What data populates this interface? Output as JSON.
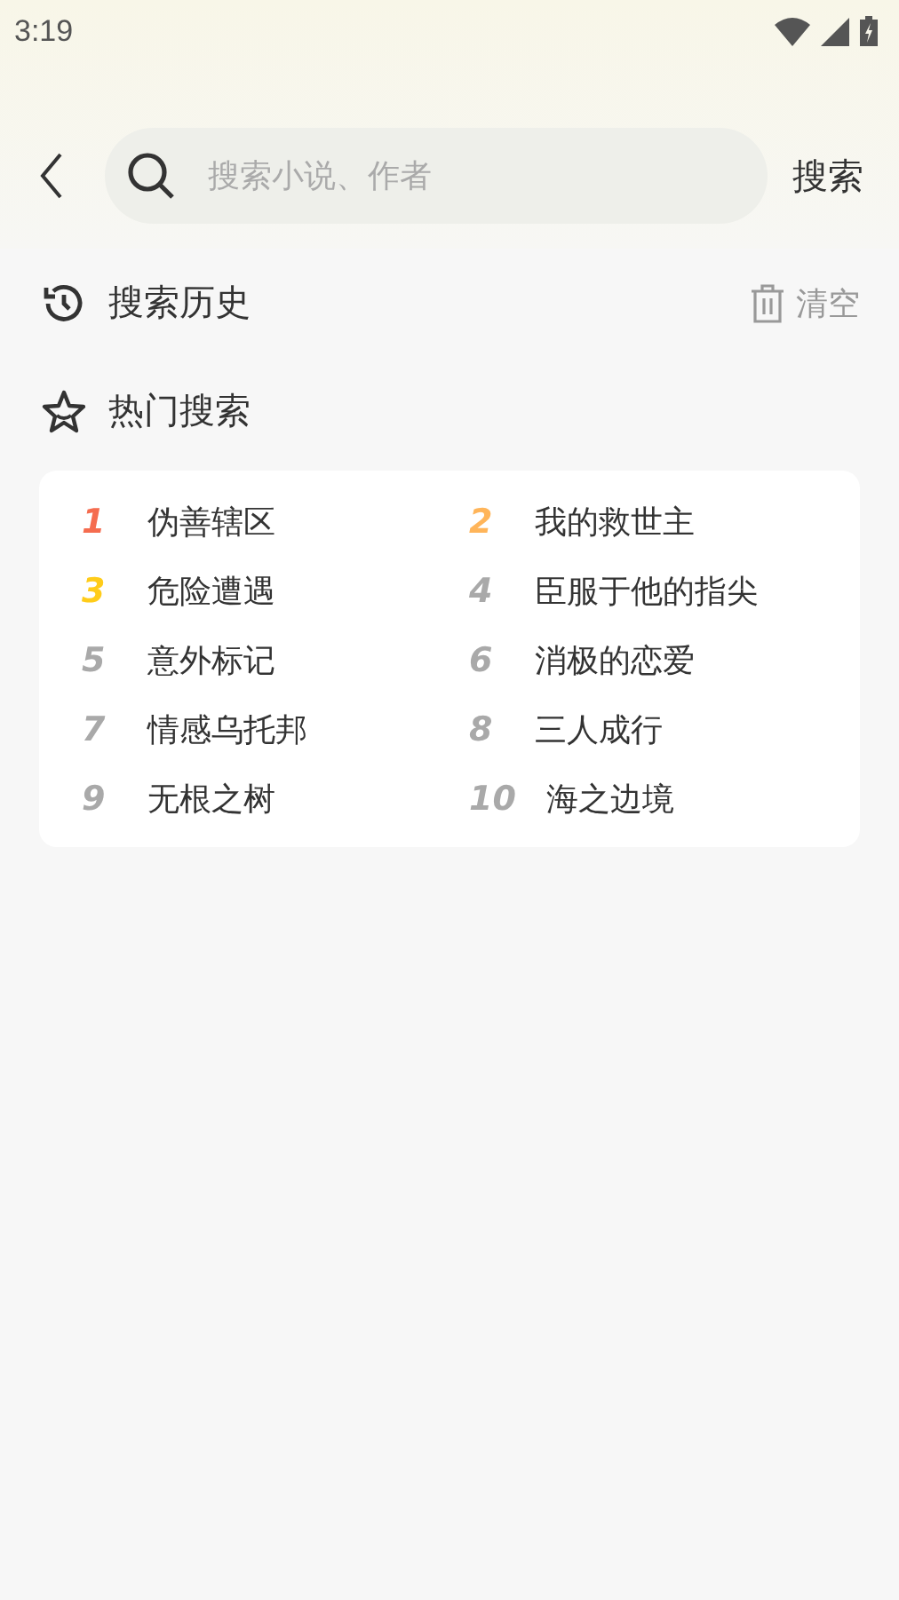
{
  "status_bar": {
    "time": "3:19"
  },
  "search": {
    "placeholder": "搜索小说、作者",
    "button": "搜索"
  },
  "history": {
    "title": "搜索历史",
    "clear": "清空"
  },
  "hot": {
    "title": "热门搜索",
    "items": [
      {
        "rank": "1",
        "title": "伪善辖区",
        "color": "#f56c4f"
      },
      {
        "rank": "2",
        "title": "我的救世主",
        "color": "#ffb55a"
      },
      {
        "rank": "3",
        "title": "危险遭遇",
        "color": "#ffcc1a"
      },
      {
        "rank": "4",
        "title": "臣服于他的指尖",
        "color": "#a9a9a9"
      },
      {
        "rank": "5",
        "title": "意外标记",
        "color": "#a9a9a9"
      },
      {
        "rank": "6",
        "title": "消极的恋爱",
        "color": "#a9a9a9"
      },
      {
        "rank": "7",
        "title": "情感乌托邦",
        "color": "#a9a9a9"
      },
      {
        "rank": "8",
        "title": "三人成行",
        "color": "#a9a9a9"
      },
      {
        "rank": "9",
        "title": "无根之树",
        "color": "#a9a9a9"
      },
      {
        "rank": "10",
        "title": "海之边境",
        "color": "#a9a9a9"
      }
    ]
  }
}
